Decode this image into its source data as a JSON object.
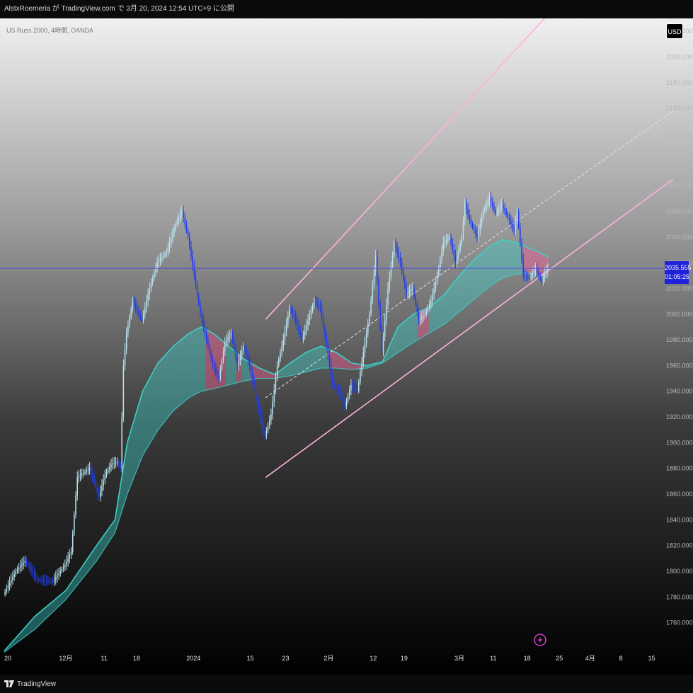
{
  "header": {
    "publish_text": "AlstxRoemeria が TradingView.com で 3月 20, 2024 12:54 UTC+9 に公開"
  },
  "symbol": {
    "text": "US Russ 2000, 4時間, OANDA"
  },
  "currency_button": {
    "label": "USD"
  },
  "price_tag": {
    "price": "2035.555",
    "countdown": "01:05:25"
  },
  "footer": {
    "brand": "TradingView"
  },
  "colors": {
    "background_top": "#f0f0f0",
    "background_bottom": "#000000",
    "candle_up": "#b8e4f0",
    "candle_down": "#1f3df0",
    "ribbon_up": "#3ecfc7",
    "ribbon_down": "#ff5a96",
    "channel_line": "#ffb0e0",
    "channel_mid": "#e6e6e6",
    "price_line": "#5050e0",
    "price_tag": "#1f22d8"
  },
  "chart_data": {
    "type": "line",
    "title": "",
    "xlabel": "",
    "ylabel": "",
    "y_axis_side": "right",
    "ylim": [
      1740,
      2230
    ],
    "y_ticks": [
      1760,
      1780,
      1800,
      1820,
      1840,
      1860,
      1880,
      1900,
      1920,
      1940,
      1960,
      1980,
      2000,
      2020,
      2040,
      2060,
      2080,
      2100,
      2120,
      2140,
      2160,
      2180,
      2200,
      2220
    ],
    "y_tick_labels": [
      "1760.000",
      "1780.000",
      "1800.000",
      "1820.000",
      "1840.000",
      "1860.000",
      "1880.000",
      "1900.000",
      "1920.000",
      "1940.000",
      "1960.000",
      "1980.000",
      "2000.000",
      "2020.000",
      "2040.000",
      "2060.000",
      "2080.000",
      "2100.000",
      "2120.000",
      "2140.000",
      "2160.000",
      "2180.000",
      "2200.000",
      "2220.000"
    ],
    "x_tick_labels": [
      "20",
      "12月",
      "11",
      "18",
      "2024",
      "15",
      "23",
      "2月",
      "12",
      "19",
      "3月",
      "11",
      "18",
      "25",
      "4月",
      "8",
      "15"
    ],
    "x_tick_index": [
      0,
      40,
      65,
      86,
      123,
      160,
      183,
      211,
      240,
      260,
      296,
      318,
      340,
      361,
      381,
      401,
      421
    ],
    "x_count": 430,
    "series": [
      {
        "name": "",
        "kind": "price",
        "points": [
          [
            0,
            1782
          ],
          [
            8,
            1800
          ],
          [
            14,
            1808
          ],
          [
            22,
            1793
          ],
          [
            32,
            1792
          ],
          [
            40,
            1805
          ],
          [
            44,
            1815
          ],
          [
            48,
            1873
          ],
          [
            56,
            1880
          ],
          [
            62,
            1858
          ],
          [
            66,
            1875
          ],
          [
            70,
            1883
          ],
          [
            74,
            1885
          ],
          [
            76,
            1880
          ],
          [
            78,
            1960
          ],
          [
            80,
            1985
          ],
          [
            84,
            2010
          ],
          [
            86,
            2005
          ],
          [
            90,
            1995
          ],
          [
            95,
            2020
          ],
          [
            100,
            2040
          ],
          [
            106,
            2048
          ],
          [
            112,
            2070
          ],
          [
            116,
            2080
          ],
          [
            120,
            2060
          ],
          [
            124,
            2030
          ],
          [
            128,
            2000
          ],
          [
            132,
            1980
          ],
          [
            136,
            1960
          ],
          [
            140,
            1950
          ],
          [
            144,
            1978
          ],
          [
            148,
            1985
          ],
          [
            152,
            1960
          ],
          [
            156,
            1975
          ],
          [
            160,
            1960
          ],
          [
            164,
            1938
          ],
          [
            168,
            1913
          ],
          [
            170,
            1905
          ],
          [
            174,
            1922
          ],
          [
            178,
            1960
          ],
          [
            182,
            1980
          ],
          [
            186,
            2005
          ],
          [
            190,
            1995
          ],
          [
            194,
            1980
          ],
          [
            198,
            1995
          ],
          [
            202,
            2010
          ],
          [
            206,
            2005
          ],
          [
            210,
            1975
          ],
          [
            214,
            1945
          ],
          [
            218,
            1940
          ],
          [
            222,
            1928
          ],
          [
            226,
            1945
          ],
          [
            230,
            1940
          ],
          [
            234,
            1970
          ],
          [
            238,
            2000
          ],
          [
            242,
            2045
          ],
          [
            246,
            1970
          ],
          [
            250,
            2020
          ],
          [
            254,
            2055
          ],
          [
            258,
            2040
          ],
          [
            262,
            2015
          ],
          [
            266,
            2020
          ],
          [
            270,
            1995
          ],
          [
            274,
            2000
          ],
          [
            278,
            2010
          ],
          [
            282,
            2030
          ],
          [
            286,
            2055
          ],
          [
            290,
            2060
          ],
          [
            294,
            2040
          ],
          [
            298,
            2060
          ],
          [
            300,
            2085
          ],
          [
            304,
            2070
          ],
          [
            308,
            2060
          ],
          [
            312,
            2080
          ],
          [
            316,
            2090
          ],
          [
            320,
            2078
          ],
          [
            324,
            2085
          ],
          [
            328,
            2075
          ],
          [
            332,
            2065
          ],
          [
            334,
            2080
          ],
          [
            338,
            2030
          ],
          [
            342,
            2028
          ],
          [
            346,
            2035
          ],
          [
            348,
            2030
          ],
          [
            350,
            2025
          ],
          [
            352,
            2032
          ],
          [
            354,
            2035
          ]
        ]
      },
      {
        "name": "",
        "kind": "ribbon-fast",
        "points": [
          [
            0,
            1738
          ],
          [
            20,
            1765
          ],
          [
            40,
            1785
          ],
          [
            60,
            1820
          ],
          [
            72,
            1840
          ],
          [
            80,
            1900
          ],
          [
            90,
            1940
          ],
          [
            100,
            1962
          ],
          [
            110,
            1975
          ],
          [
            120,
            1985
          ],
          [
            128,
            1990
          ],
          [
            136,
            1985
          ],
          [
            146,
            1975
          ],
          [
            156,
            1965
          ],
          [
            166,
            1958
          ],
          [
            176,
            1953
          ],
          [
            186,
            1962
          ],
          [
            196,
            1970
          ],
          [
            206,
            1975
          ],
          [
            216,
            1970
          ],
          [
            226,
            1962
          ],
          [
            236,
            1960
          ],
          [
            246,
            1963
          ],
          [
            256,
            1990
          ],
          [
            266,
            2000
          ],
          [
            276,
            2005
          ],
          [
            286,
            2015
          ],
          [
            296,
            2030
          ],
          [
            306,
            2043
          ],
          [
            316,
            2053
          ],
          [
            324,
            2058
          ],
          [
            332,
            2056
          ],
          [
            340,
            2052
          ],
          [
            348,
            2048
          ],
          [
            354,
            2044
          ]
        ]
      },
      {
        "name": "",
        "kind": "ribbon-slow",
        "points": [
          [
            0,
            1737
          ],
          [
            20,
            1755
          ],
          [
            40,
            1778
          ],
          [
            60,
            1808
          ],
          [
            72,
            1830
          ],
          [
            80,
            1860
          ],
          [
            90,
            1890
          ],
          [
            100,
            1910
          ],
          [
            110,
            1925
          ],
          [
            120,
            1935
          ],
          [
            128,
            1940
          ],
          [
            136,
            1942
          ],
          [
            146,
            1945
          ],
          [
            156,
            1948
          ],
          [
            166,
            1950
          ],
          [
            176,
            1950
          ],
          [
            186,
            1952
          ],
          [
            196,
            1955
          ],
          [
            206,
            1958
          ],
          [
            216,
            1958
          ],
          [
            226,
            1957
          ],
          [
            236,
            1958
          ],
          [
            246,
            1962
          ],
          [
            256,
            1970
          ],
          [
            266,
            1978
          ],
          [
            276,
            1985
          ],
          [
            286,
            1992
          ],
          [
            296,
            2002
          ],
          [
            306,
            2012
          ],
          [
            316,
            2022
          ],
          [
            324,
            2028
          ],
          [
            332,
            2031
          ],
          [
            340,
            2032
          ],
          [
            348,
            2030
          ],
          [
            354,
            2028
          ]
        ]
      }
    ],
    "channel": {
      "upper": [
        [
          170,
          1996
        ],
        [
          356,
          2236
        ]
      ],
      "lower": [
        [
          170,
          1873
        ],
        [
          435,
          2105
        ]
      ],
      "middle": [
        [
          170,
          1935
        ],
        [
          435,
          2158
        ]
      ]
    },
    "last_price": 2035.555,
    "grid": false,
    "legend": "none"
  }
}
